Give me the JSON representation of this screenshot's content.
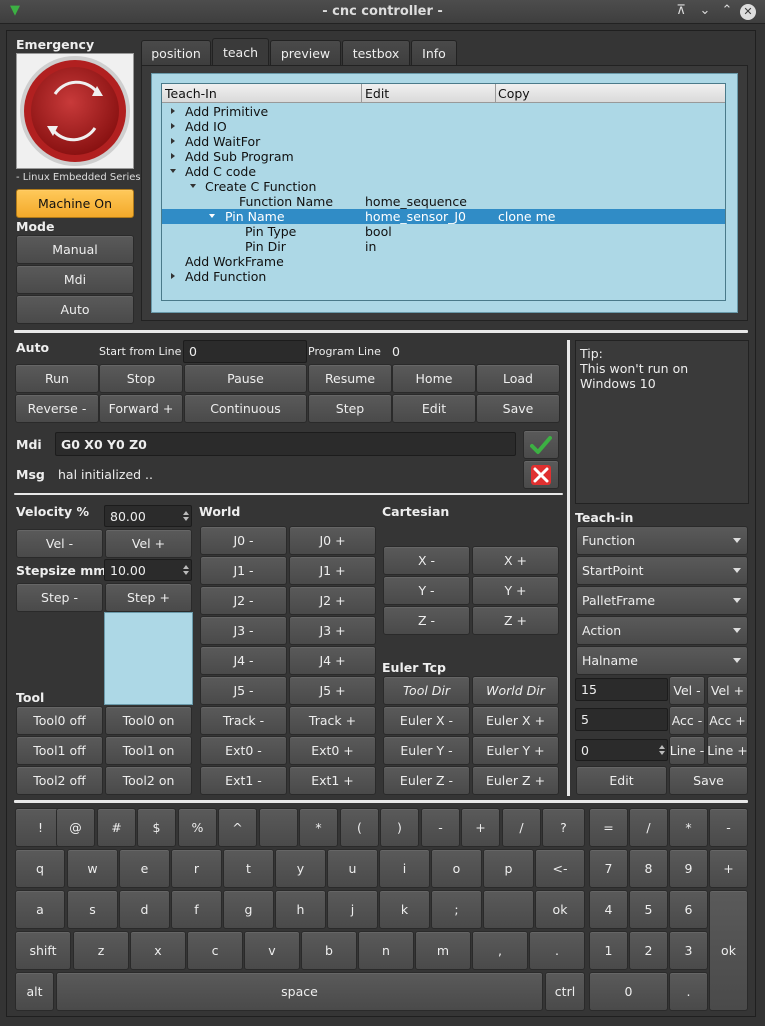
{
  "window": {
    "title": "- cnc controller -"
  },
  "emergency": {
    "label": "Emergency",
    "caption": "- Linux Embedded Series-",
    "machine_on": "Machine On"
  },
  "mode": {
    "label": "Mode",
    "buttons": [
      "Manual",
      "Mdi",
      "Auto"
    ]
  },
  "tabs": [
    "position",
    "teach",
    "preview",
    "testbox",
    "Info"
  ],
  "tree": {
    "headers": [
      "Teach-In",
      "Edit",
      "Copy"
    ],
    "rows": [
      {
        "text": "Add Primitive",
        "edit": "",
        "copy": ""
      },
      {
        "text": "Add IO",
        "edit": "",
        "copy": ""
      },
      {
        "text": "Add WaitFor",
        "edit": "",
        "copy": ""
      },
      {
        "text": "Add Sub Program",
        "edit": "",
        "copy": ""
      },
      {
        "text": "Add C code",
        "edit": "",
        "copy": ""
      },
      {
        "text": "Create C Function",
        "edit": "",
        "copy": ""
      },
      {
        "text": "Function Name",
        "edit": "home_sequence",
        "copy": ""
      },
      {
        "text": "Pin Name",
        "edit": "home_sensor_J0",
        "copy": "clone me"
      },
      {
        "text": "Pin Type",
        "edit": "bool",
        "copy": ""
      },
      {
        "text": "Pin Dir",
        "edit": "in",
        "copy": ""
      },
      {
        "text": "Add WorkFrame",
        "edit": "",
        "copy": ""
      },
      {
        "text": "Add Function",
        "edit": "",
        "copy": ""
      }
    ]
  },
  "auto": {
    "label": "Auto",
    "start_from_line_label": "Start from Line",
    "start_from_line_value": "0",
    "program_line_label": "Program Line",
    "program_line_value": "0",
    "row1": [
      "Run",
      "Stop",
      "Pause",
      "Resume",
      "Home",
      "Load"
    ],
    "row2": [
      "Reverse -",
      "Forward +",
      "Continuous",
      "Step",
      "Edit",
      "Save"
    ]
  },
  "tip": {
    "title": "Tip:",
    "text_line1": "This won't run on",
    "text_line2": "Windows 10"
  },
  "mdi": {
    "label": "Mdi",
    "value": "G0 X0 Y0 Z0"
  },
  "msg": {
    "label": "Msg",
    "value": "hal initialized .."
  },
  "velocity": {
    "label": "Velocity %",
    "value": "80.00",
    "minus": "Vel -",
    "plus": "Vel +"
  },
  "stepsize": {
    "label": "Stepsize mm",
    "value": "10.00",
    "minus": "Step -",
    "plus": "Step +"
  },
  "tool": {
    "label": "Tool",
    "buttons": [
      [
        "Tool0 off",
        "Tool0 on"
      ],
      [
        "Tool1 off",
        "Tool1 on"
      ],
      [
        "Tool2 off",
        "Tool2 on"
      ]
    ]
  },
  "world": {
    "label": "World",
    "buttons": [
      [
        "J0 -",
        "J0 +"
      ],
      [
        "J1 -",
        "J1 +"
      ],
      [
        "J2 -",
        "J2 +"
      ],
      [
        "J3 -",
        "J3 +"
      ],
      [
        "J4 -",
        "J4 +"
      ],
      [
        "J5 -",
        "J5 +"
      ],
      [
        "Track -",
        "Track +"
      ],
      [
        "Ext0 -",
        "Ext0 +"
      ],
      [
        "Ext1 -",
        "Ext1 +"
      ]
    ]
  },
  "cartesian": {
    "label": "Cartesian",
    "buttons": [
      [
        "X -",
        "X +"
      ],
      [
        "Y -",
        "Y +"
      ],
      [
        "Z -",
        "Z +"
      ]
    ]
  },
  "euler": {
    "label": "Euler Tcp",
    "buttons": [
      [
        "Tool Dir",
        "World Dir"
      ],
      [
        "Euler X -",
        "Euler X +"
      ],
      [
        "Euler Y -",
        "Euler Y +"
      ],
      [
        "Euler Z -",
        "Euler Z +"
      ]
    ]
  },
  "teachin": {
    "label": "Teach-in",
    "combos": [
      "Function",
      "StartPoint",
      "PalletFrame",
      "Action",
      "Halname"
    ],
    "vel_value": "15",
    "vel_minus": "Vel -",
    "vel_plus": "Vel +",
    "acc_value": "5",
    "acc_minus": "Acc -",
    "acc_plus": "Acc +",
    "line_value": "0",
    "line_minus": "Line -",
    "line_plus": "Line +",
    "edit": "Edit",
    "save": "Save"
  },
  "keyboard": {
    "row1": [
      "!",
      "@",
      "#",
      "$",
      "%",
      "^",
      "",
      "*",
      "(",
      ")",
      "-",
      "+",
      "/",
      "?"
    ],
    "row2": [
      "q",
      "w",
      "e",
      "r",
      "t",
      "y",
      "u",
      "i",
      "o",
      "p",
      "<-"
    ],
    "row3": [
      "a",
      "s",
      "d",
      "f",
      "g",
      "h",
      "j",
      "k",
      ";",
      "",
      "ok"
    ],
    "row4": [
      "shift",
      "z",
      "x",
      "c",
      "v",
      "b",
      "n",
      "m",
      ",",
      "."
    ],
    "row5": [
      "alt",
      "space",
      "ctrl"
    ],
    "numpad": {
      "row1": [
        "=",
        "/",
        "*",
        "-"
      ],
      "row2": [
        "7",
        "8",
        "9",
        "+"
      ],
      "row3": [
        "4",
        "5",
        "6"
      ],
      "row4": [
        "1",
        "2",
        "3"
      ],
      "row5": [
        "0",
        "."
      ],
      "ok": "ok"
    }
  },
  "colors": {
    "accent": "#f8b73a",
    "tree_bg": "#add8e6",
    "selection": "#308cc6",
    "check": "#3cb043",
    "cross": "#e03030"
  }
}
